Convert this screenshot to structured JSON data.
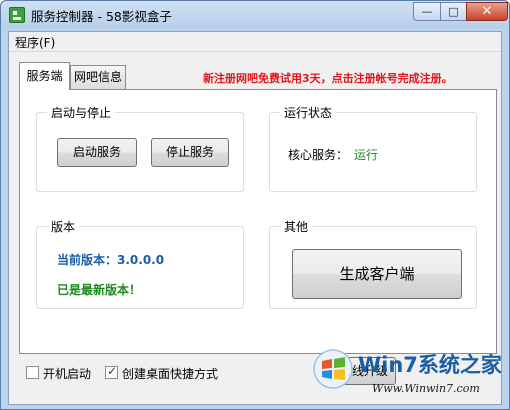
{
  "window": {
    "title": "服务控制器 - 58影视盒子"
  },
  "titlebar_buttons": {
    "minimize": "—",
    "maximize": "□",
    "close": "✕"
  },
  "menu": {
    "items": [
      {
        "label": "程序(F)"
      }
    ]
  },
  "tabs": [
    {
      "label": "服务端",
      "active": true
    },
    {
      "label": "网吧信息",
      "active": false
    }
  ],
  "notice": "新注册网吧免费试用3天，点击注册帐号完成注册。",
  "service": {
    "title": "启动与停止",
    "start_label": "启动服务",
    "stop_label": "停止服务"
  },
  "status": {
    "title": "运行状态",
    "core_label": "核心服务：",
    "core_value": "运行"
  },
  "version": {
    "title": "版本",
    "current": "当前版本：3.0.0.0",
    "latest": "已是最新版本！"
  },
  "other": {
    "title": "其他",
    "generate_label": "生成客户端"
  },
  "options": [
    {
      "label": "开机启动",
      "checked": false
    },
    {
      "label": "创建桌面快捷方式",
      "checked": true
    }
  ],
  "online_button": {
    "label": "在线升级"
  },
  "watermark": {
    "title": "Win7系统之家",
    "url": "Www.Winwin7.com"
  },
  "colors": {
    "notice": "#e2161d",
    "version_blue": "#1a5ea8",
    "status_green": "#1d8a1d"
  }
}
